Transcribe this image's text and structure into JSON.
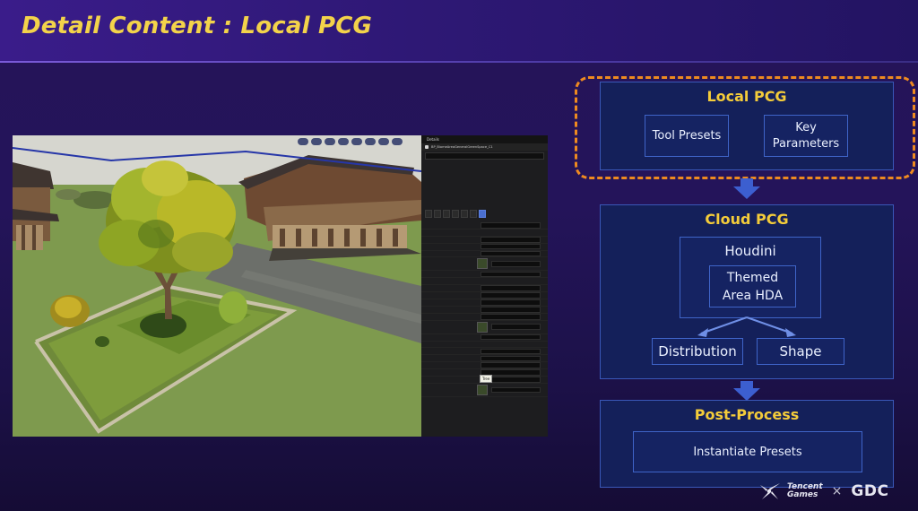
{
  "slide": {
    "title": "Detail Content : Local PCG"
  },
  "editor": {
    "details_tab": "Details",
    "actor_name": "BP_BiomeAreaGeneralGreenSpace_C1",
    "tooltip": "Tree"
  },
  "flow": {
    "local_pcg": {
      "title": "Local PCG",
      "items": [
        "Tool Presets",
        "Key\nParameters"
      ]
    },
    "cloud_pcg": {
      "title": "Cloud PCG",
      "houdini": "Houdini",
      "hda": "Themed\nArea HDA",
      "distribution": "Distribution",
      "shape": "Shape"
    },
    "post_process": {
      "title": "Post-Process",
      "item": "Instantiate Presets"
    },
    "colors": {
      "title_yellow": "#f4cc3a",
      "box_border": "#3a58b8",
      "dashed_orange": "#ee8a20",
      "arrow": "#3c5fd0"
    }
  },
  "footer": {
    "tencent_line1": "Tencent",
    "tencent_line2": "Games",
    "separator": "×",
    "gdc": "GDC"
  }
}
